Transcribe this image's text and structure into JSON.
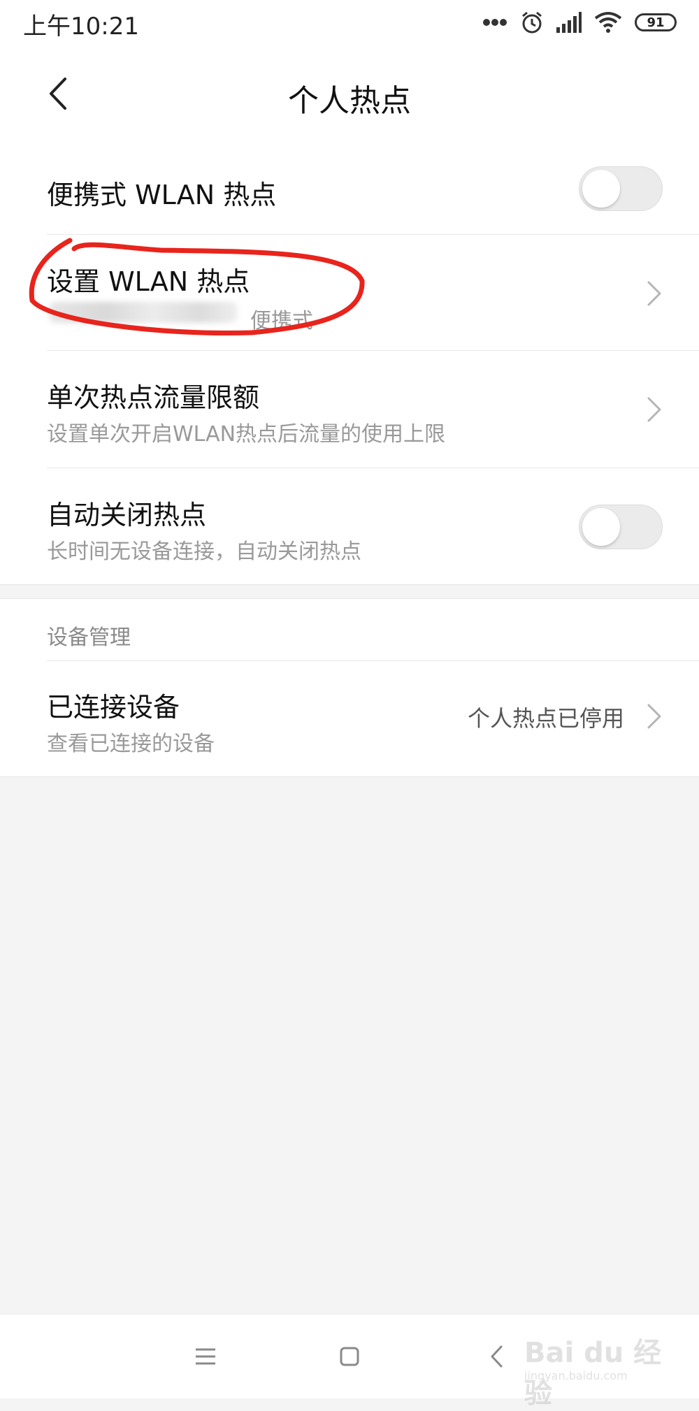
{
  "status_bar": {
    "time": "上午10:21",
    "battery": "91",
    "icons": [
      "more-dots-icon",
      "alarm-clock-icon",
      "signal-icon",
      "wifi-icon",
      "battery-icon"
    ]
  },
  "header": {
    "title": "个人热点",
    "back_icon": "chevron-left-icon"
  },
  "settings": {
    "portable_hotspot": {
      "title": "便携式 WLAN 热点",
      "enabled": false
    },
    "setup_hotspot": {
      "title": "设置 WLAN 热点",
      "subtitle": "便携式"
    },
    "data_limit": {
      "title": "单次热点流量限额",
      "subtitle": "设置单次开启WLAN热点后流量的使用上限"
    },
    "auto_close": {
      "title": "自动关闭热点",
      "subtitle": "长时间无设备连接，自动关闭热点",
      "enabled": false
    }
  },
  "device_management": {
    "header": "设备管理",
    "connected_devices": {
      "title": "已连接设备",
      "subtitle": "查看已连接的设备",
      "status": "个人热点已停用"
    }
  },
  "nav_bar": {
    "icons": [
      "menu-icon",
      "home-square-icon",
      "back-icon"
    ]
  },
  "watermark": {
    "main": "Bai du 经验",
    "sub": "jingyan.baidu.com"
  },
  "colors": {
    "annotation": "#e8241c",
    "background": "#f4f4f4",
    "card": "#ffffff",
    "subtext": "#999999"
  }
}
